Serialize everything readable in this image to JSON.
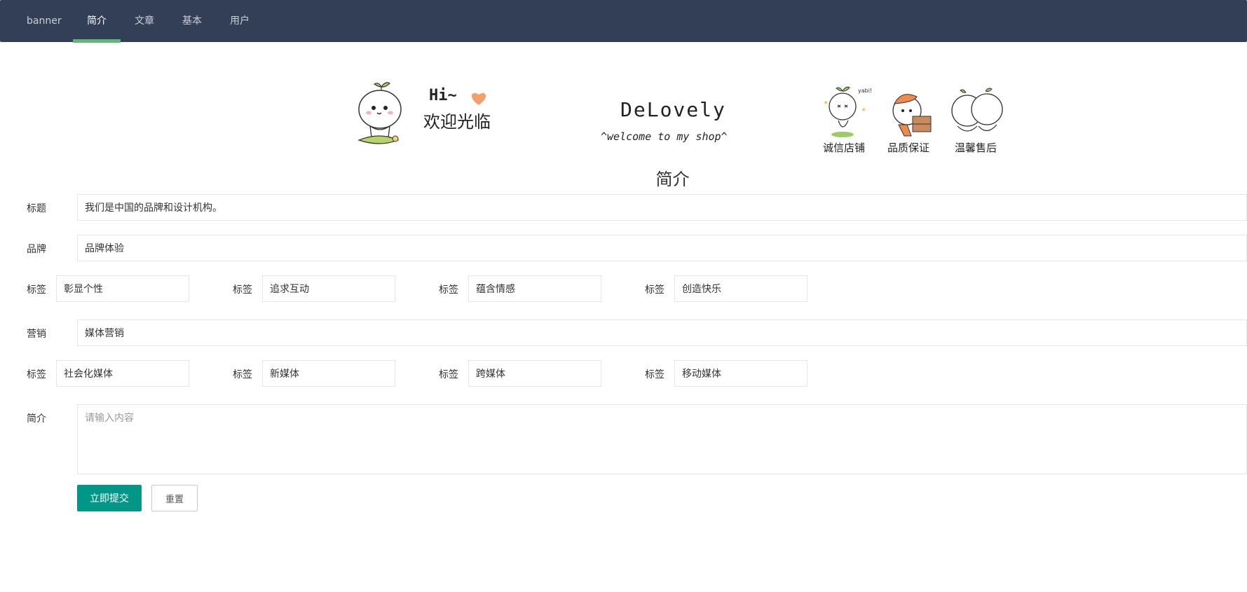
{
  "nav": {
    "items": [
      {
        "label": "banner"
      },
      {
        "label": "简介"
      },
      {
        "label": "文章"
      },
      {
        "label": "基本"
      },
      {
        "label": "用户"
      }
    ],
    "active_index": 1,
    "background": "#323f56",
    "active_indicator_color": "#5fb878"
  },
  "banner": {
    "greeting": "Hi~",
    "welcome": "欢迎光临",
    "brand": "DeLovely",
    "tagline": "^welcome to my shop^",
    "badges": [
      "诚信店铺",
      "品质保证",
      "温馨售后"
    ],
    "sticker_text": "yabi!"
  },
  "section_title": "简介",
  "form": {
    "title": {
      "label": "标题",
      "value": "我们是中国的品牌和设计机构。"
    },
    "brand": {
      "label": "品牌",
      "value": "品牌体验"
    },
    "brand_tags": [
      {
        "label": "标签",
        "value": "彰显个性"
      },
      {
        "label": "标签",
        "value": "追求互动"
      },
      {
        "label": "标签",
        "value": "蕴含情感"
      },
      {
        "label": "标签",
        "value": "创造快乐"
      }
    ],
    "marketing": {
      "label": "营销",
      "value": "媒体营销"
    },
    "marketing_tags": [
      {
        "label": "标签",
        "value": "社会化媒体"
      },
      {
        "label": "标签",
        "value": "新媒体"
      },
      {
        "label": "标签",
        "value": "跨媒体"
      },
      {
        "label": "标签",
        "value": "移动媒体"
      }
    ],
    "intro": {
      "label": "简介",
      "value": "",
      "placeholder": "请输入内容"
    },
    "submit_label": "立即提交",
    "reset_label": "重置",
    "primary_color": "#009688"
  }
}
